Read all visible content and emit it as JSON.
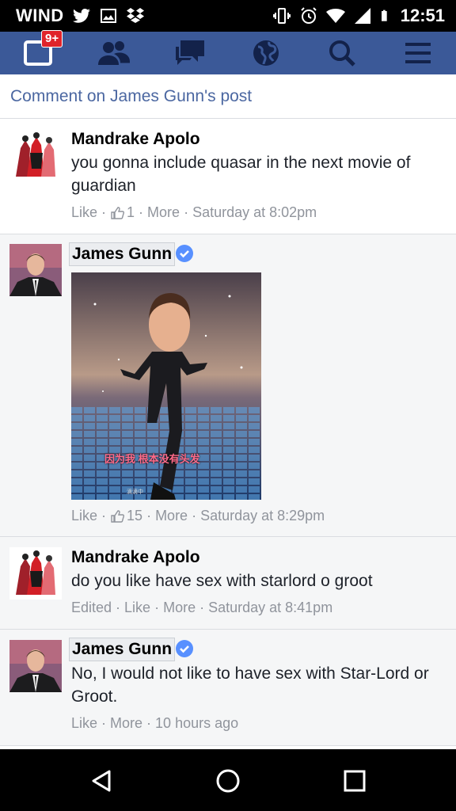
{
  "status_bar": {
    "carrier": "WIND",
    "time": "12:51"
  },
  "navbar": {
    "notifications_badge": "9+",
    "items": [
      "notifications-icon",
      "friends-icon",
      "messages-icon",
      "globe-icon",
      "search-icon",
      "menu-icon"
    ]
  },
  "header": {
    "title": "Comment on James Gunn's post"
  },
  "comments": [
    {
      "author": "Mandrake Apolo",
      "text": "you gonna include quasar in the next movie of guardian",
      "like": "Like",
      "like_count": "1",
      "more": "More",
      "time": "Saturday at 8:02pm"
    },
    {
      "author": "James Gunn",
      "verified": true,
      "image_caption": "因为我 根本没有头发",
      "image_watermark": "滴滴中",
      "like": "Like",
      "like_count": "15",
      "more": "More",
      "time": "Saturday at 8:29pm"
    },
    {
      "author": "Mandrake Apolo",
      "text": "do you like have sex with starlord o groot",
      "edited": "Edited",
      "like": "Like",
      "more": "More",
      "time": "Saturday at 8:41pm"
    },
    {
      "author": "James Gunn",
      "verified": true,
      "text": "No, I would not like to have sex with Star-Lord or Groot.",
      "like": "Like",
      "more": "More",
      "time": "10 hours ago"
    }
  ],
  "colors": {
    "nav_blue": "#3b5998",
    "link_blue": "#4b67a1",
    "meta_gray": "#90949c",
    "verified_blue": "#5890ff",
    "badge_red": "#e0232a"
  }
}
